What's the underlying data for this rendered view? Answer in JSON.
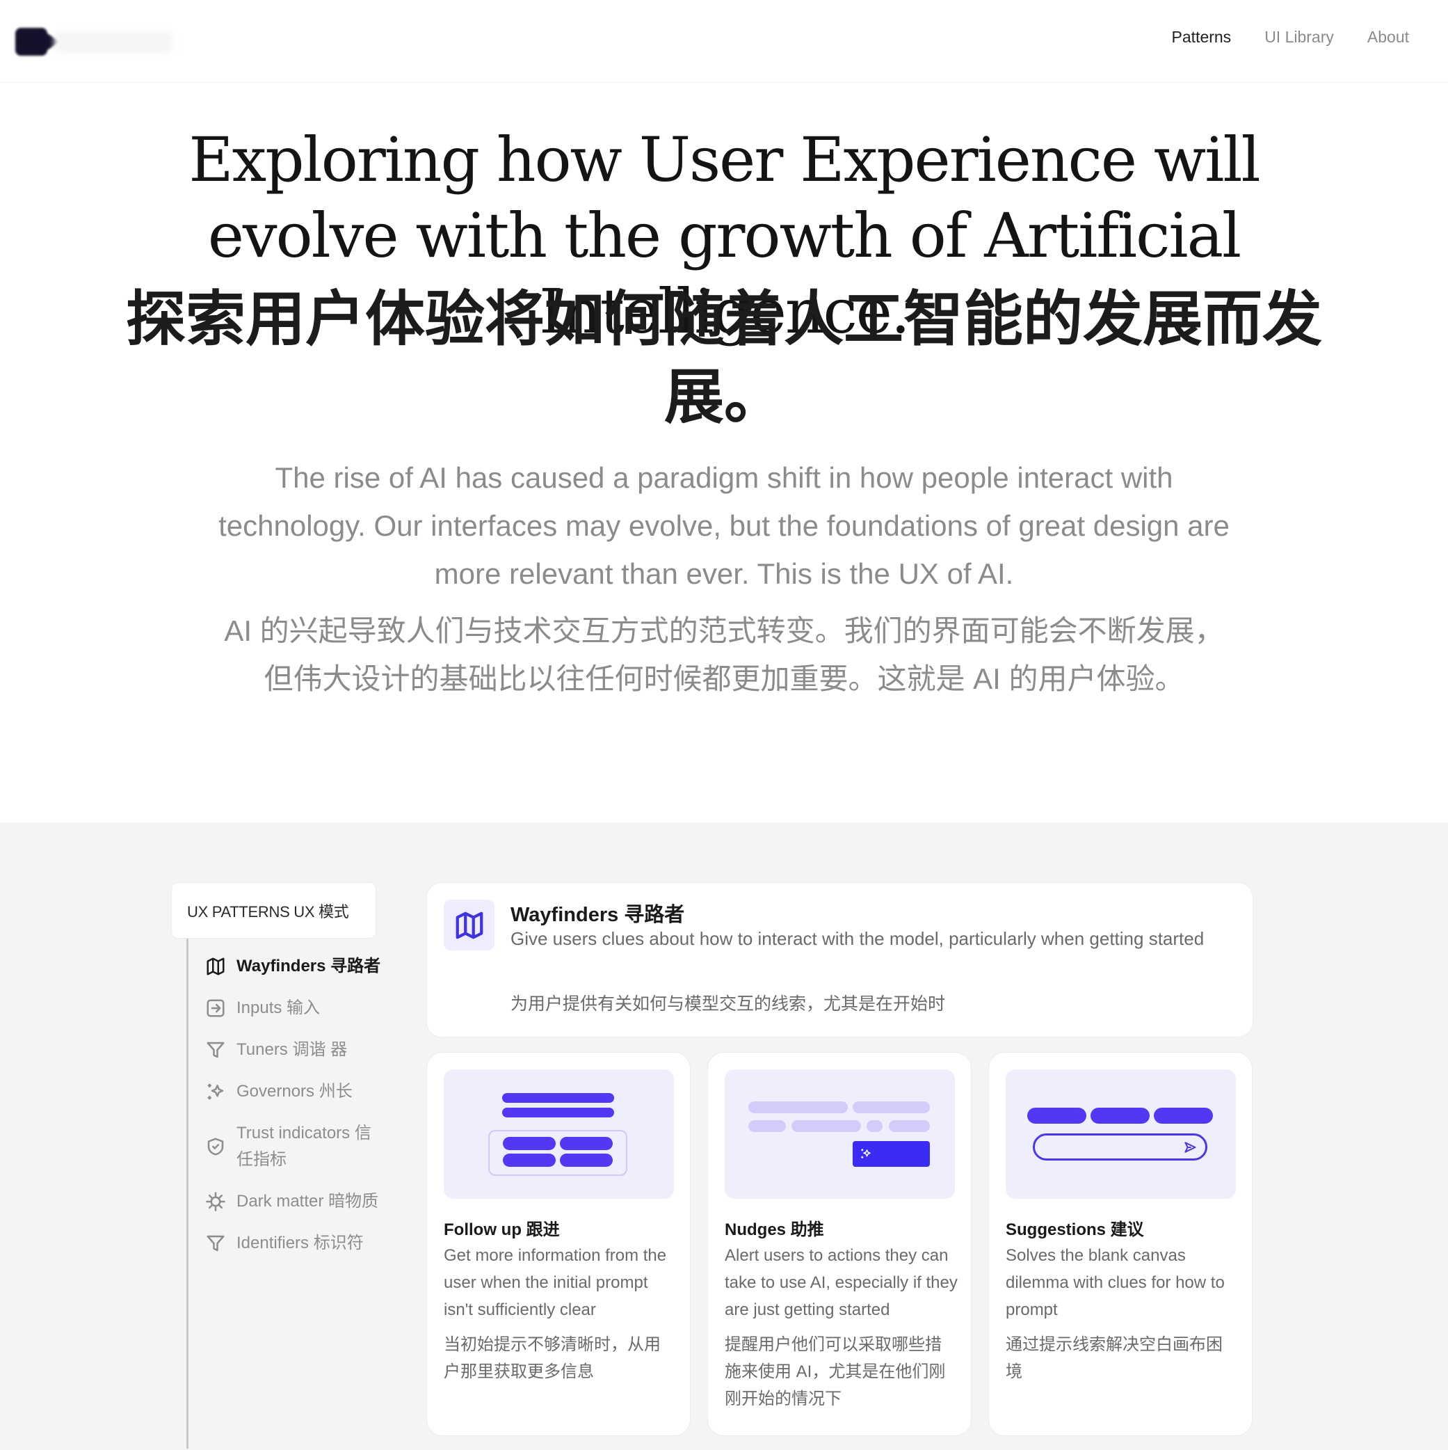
{
  "header": {
    "logo_alt": "logo",
    "nav": [
      {
        "label": "Patterns",
        "active": true
      },
      {
        "label": "UI Library",
        "active": false
      },
      {
        "label": "About",
        "active": false
      }
    ]
  },
  "hero": {
    "title": "Exploring how User Experience will evolve with the growth of Artificial Intelligence.",
    "title_zh": "探索用户体验将如何随着人工智能的发展而发展。",
    "subtitle": "The rise of AI has caused a paradigm shift in how people interact with technology. Our interfaces may evolve, but the foundations of great design are more relevant than ever. This is the UX of AI.",
    "subtitle_zh": "AI 的兴起导致人们与技术交互方式的范式转变。我们的界面可能会不断发展，但伟大设计的基础比以往任何时候都更加重要。这就是 AI 的用户体验。"
  },
  "sidebar": {
    "heading": "UX PATTERNS UX 模式",
    "items": [
      {
        "label": "Wayfinders 寻路者",
        "icon": "map-icon",
        "active": true
      },
      {
        "label": "Inputs 输入",
        "icon": "input-arrow-icon",
        "active": false
      },
      {
        "label": "Tuners 调谐 器",
        "icon": "filter-icon",
        "active": false
      },
      {
        "label": "Governors 州长",
        "icon": "sparkles-icon",
        "active": false
      },
      {
        "label": "Trust indicators 信任指标",
        "icon": "shield-check-icon",
        "active": false
      },
      {
        "label": "Dark matter 暗物质",
        "icon": "virus-icon",
        "active": false
      },
      {
        "label": "Identifiers 标识符",
        "icon": "filter-icon",
        "active": false
      }
    ]
  },
  "intro": {
    "icon": "map-icon",
    "title": "Wayfinders 寻路者",
    "description": "Give users clues about how to interact with the model, particularly when getting started",
    "description_zh": "为用户提供有关如何与模型交互的线索，尤其是在开始时"
  },
  "cards": [
    {
      "title": "Follow up 跟进",
      "description": "Get more information from the user when the initial prompt isn't sufficiently clear",
      "description_zh": "当初始提示不够清晰时，从用户那里获取更多信息",
      "illustration": "follow-up-illustration"
    },
    {
      "title": "Nudges 助推",
      "description": "Alert users to actions they can take to use AI, especially if they are just getting started",
      "description_zh": "提醒用户他们可以采取哪些措施来使用 AI，尤其是在他们刚刚开始的情况下",
      "illustration": "nudges-illustration"
    },
    {
      "title": "Suggestions 建议",
      "description": "Solves the blank canvas dilemma with clues for how to prompt",
      "description_zh": "通过提示线索解决空白画布困境",
      "illustration": "suggestions-illustration"
    }
  ],
  "colors": {
    "accent": "#5238f5",
    "accent_light": "#d3ccfb",
    "illustration_bg": "#efeefd",
    "section_bg": "#f4f4f4",
    "muted_text": "#8b8b8b"
  }
}
